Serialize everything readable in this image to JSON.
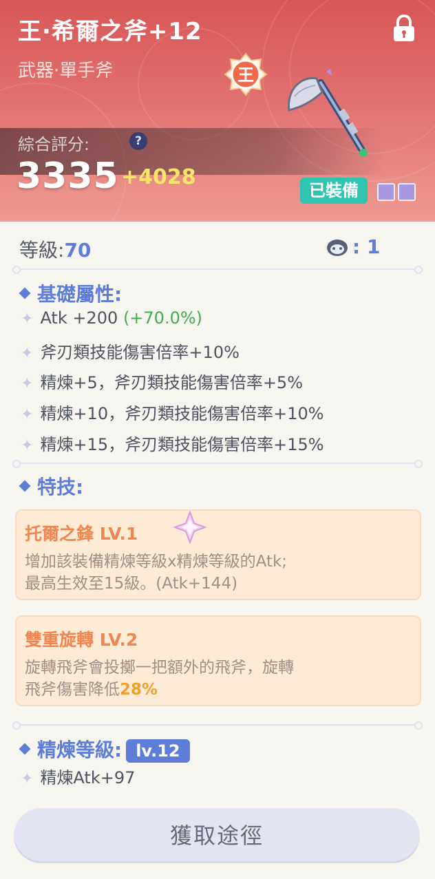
{
  "item": {
    "name": "王·希爾之斧+12",
    "type": "武器·單手斧",
    "score_label": "綜合評分:",
    "score": "3335",
    "score_delta": "+4028",
    "equipped_label": "已裝備",
    "help_glyph": "?",
    "king_glyph": "王"
  },
  "level": {
    "label": "等級:",
    "value": "70",
    "pet_count": ": 1"
  },
  "base_stats": {
    "title": "基礎屬性:",
    "atk": "Atk +200",
    "atk_bonus": "(+70.0%)",
    "lines": [
      "斧刃類技能傷害倍率+10%",
      "精煉+5，斧刃類技能傷害倍率+5%",
      "精煉+10，斧刃類技能傷害倍率+10%",
      "精煉+15，斧刃類技能傷害倍率+15%"
    ]
  },
  "specials": {
    "title": "特技:",
    "skills": [
      {
        "name": "托爾之鋒 LV.1",
        "desc_line1": "增加該裝備精煉等級x精煉等級的Atk;",
        "desc_line2": "最高生效至15級。(Atk+144)"
      },
      {
        "name": "雙重旋轉 LV.2",
        "desc_line1": "旋轉飛斧會投擲一把額外的飛斧，旋轉",
        "desc_line2_prefix": "飛斧傷害降低",
        "desc_line2_value": "28%"
      }
    ]
  },
  "refine": {
    "title": "精煉等級:",
    "level_badge": "lv.12",
    "line": "精煉Atk+97"
  },
  "obtain_button": "獲取途徑",
  "colors": {
    "accent": "#5d7dd8",
    "header": "#d85656",
    "equipped": "#2fc4b0",
    "skill_name": "#ef8650"
  }
}
